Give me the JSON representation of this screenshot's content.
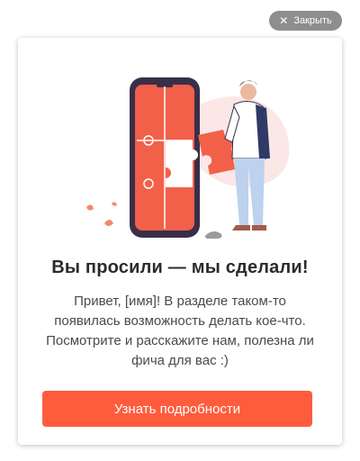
{
  "close_button": {
    "label": "Закрыть",
    "icon": "close-icon"
  },
  "card": {
    "title": "Вы просили — мы сделали!",
    "body": "Привет, [имя]! В разделе таком-то появилась возможность делать кое-что.  Посмотрите и расскажите нам, полезна ли фича для вас :)",
    "cta_label": "Узнать подробности"
  },
  "colors": {
    "accent": "#ff5c3d",
    "close_bg": "#8e8e8e",
    "blob": "#fbe7e6"
  }
}
